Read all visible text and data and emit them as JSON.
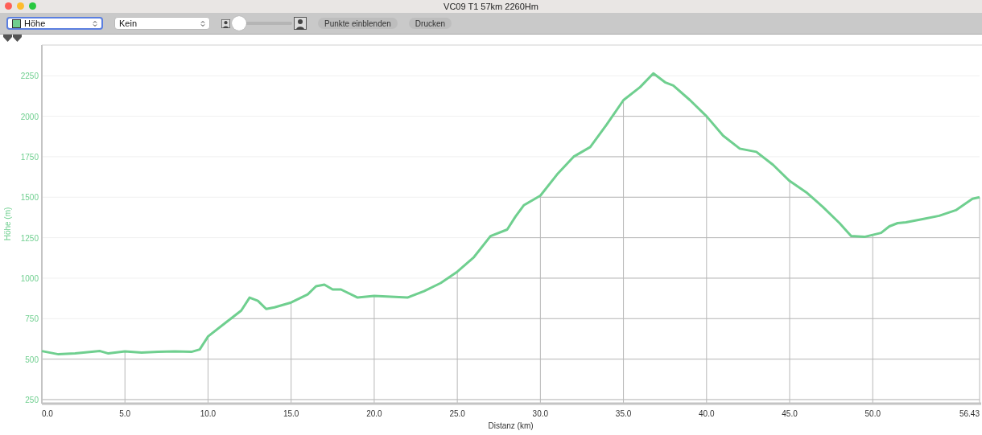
{
  "window": {
    "title": "VC09 T1 57km 2260Hm"
  },
  "toolbar": {
    "series_select": {
      "value": "Höhe",
      "color": "#6fcf8f",
      "focused": true
    },
    "compare_select": {
      "value": "Kein",
      "focused": false
    },
    "zoom_slider": {
      "level": 0.0
    },
    "buttons": [
      "Punkte einblenden",
      "Drucken"
    ]
  },
  "markers": [
    {
      "kind": "marker"
    },
    {
      "kind": "marker"
    }
  ],
  "chart": {
    "chart_data": {
      "type": "line",
      "xlabel": "Distanz (km)",
      "ylabel": "Höhe (m)",
      "x": [
        0,
        1,
        2,
        3,
        3.5,
        4,
        5,
        6,
        7,
        8,
        9,
        9.5,
        10,
        11,
        12,
        12.5,
        13,
        13.5,
        14,
        15,
        16,
        16.5,
        17,
        17.5,
        18,
        19,
        20,
        21,
        22,
        23,
        24,
        25,
        26,
        27,
        28,
        28.5,
        29,
        30,
        31,
        32,
        33,
        34,
        35,
        36,
        36.8,
        37.5,
        38,
        39,
        40,
        41,
        42,
        43,
        44,
        45,
        46,
        47,
        48,
        48.7,
        49.5,
        50.5,
        51,
        51.5,
        52,
        53,
        54,
        55,
        56,
        56.43
      ],
      "grid": true,
      "ref_lines": [
        {
          "axis": "x",
          "value": 5
        },
        {
          "axis": "x",
          "value": 10
        },
        {
          "axis": "x",
          "value": 15
        },
        {
          "axis": "x",
          "value": 20
        },
        {
          "axis": "x",
          "value": 25
        },
        {
          "axis": "x",
          "value": 30
        },
        {
          "axis": "x",
          "value": 35
        },
        {
          "axis": "x",
          "value": 40
        },
        {
          "axis": "x",
          "value": 45
        },
        {
          "axis": "x",
          "value": 50
        },
        {
          "axis": "x",
          "value": 56.43
        }
      ],
      "series": [
        {
          "color": "#6fcf8f",
          "values": [
            550,
            530,
            535,
            545,
            550,
            535,
            548,
            540,
            545,
            548,
            545,
            560,
            640,
            720,
            800,
            880,
            860,
            810,
            820,
            850,
            900,
            950,
            960,
            930,
            930,
            880,
            890,
            885,
            880,
            920,
            970,
            1040,
            1130,
            1260,
            1300,
            1380,
            1450,
            1510,
            1640,
            1750,
            1810,
            1950,
            2100,
            2180,
            2265,
            2210,
            2190,
            2100,
            2000,
            1880,
            1800,
            1780,
            1700,
            1600,
            1530,
            1440,
            1340,
            1260,
            1255,
            1280,
            1320,
            1340,
            1345,
            1365,
            1385,
            1420,
            1490,
            1500
          ]
        }
      ],
      "xlim": [
        0,
        56.43
      ],
      "ylim": [
        230,
        2440
      ],
      "xticks": [
        {
          "value": 0,
          "label": "0.0"
        },
        {
          "value": 5,
          "label": "5.0"
        },
        {
          "value": 10,
          "label": "10.0"
        },
        {
          "value": 15,
          "label": "15.0"
        },
        {
          "value": 20,
          "label": "20.0"
        },
        {
          "value": 25,
          "label": "25.0"
        },
        {
          "value": 30,
          "label": "30.0"
        },
        {
          "value": 35,
          "label": "35.0"
        },
        {
          "value": 40,
          "label": "40.0"
        },
        {
          "value": 45,
          "label": "45.0"
        },
        {
          "value": 50,
          "label": "50.0"
        },
        {
          "value": 56.43,
          "label": "56.43"
        }
      ],
      "yticks": [
        250,
        500,
        750,
        1000,
        1250,
        1500,
        1750,
        2000,
        2250
      ]
    }
  }
}
